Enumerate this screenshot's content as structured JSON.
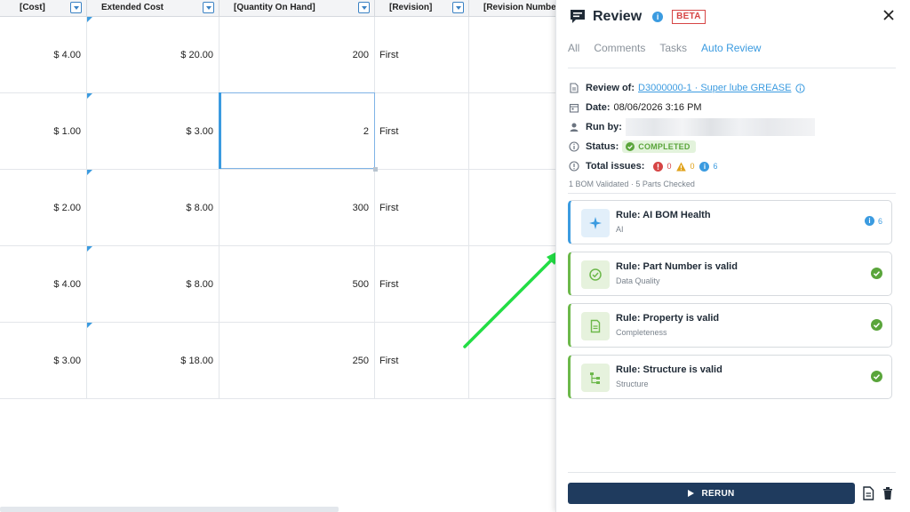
{
  "grid": {
    "columns": [
      "[Cost]",
      "Extended Cost",
      "[Quantity On Hand]",
      "[Revision]",
      "[Revision Number"
    ],
    "rows": [
      {
        "cost": "$ 4.00",
        "extended_cost": "$ 20.00",
        "qty": "200",
        "revision": "First"
      },
      {
        "cost": "$ 1.00",
        "extended_cost": "$ 3.00",
        "qty": "2",
        "revision": "First"
      },
      {
        "cost": "$ 2.00",
        "extended_cost": "$ 8.00",
        "qty": "300",
        "revision": "First"
      },
      {
        "cost": "$ 4.00",
        "extended_cost": "$ 8.00",
        "qty": "500",
        "revision": "First"
      },
      {
        "cost": "$ 3.00",
        "extended_cost": "$ 18.00",
        "qty": "250",
        "revision": "First"
      }
    ]
  },
  "panel": {
    "title": "Review",
    "beta": "BETA",
    "tabs": [
      "All",
      "Comments",
      "Tasks",
      "Auto Review"
    ],
    "active_tab": "Auto Review",
    "review_of_label": "Review of:",
    "review_of_value": "D3000000-1 · Super lube GREASE",
    "date_label": "Date:",
    "date_value": "08/06/2026 3:16 PM",
    "run_by_label": "Run by:",
    "status_label": "Status:",
    "status_value": "COMPLETED",
    "issues_label": "Total issues:",
    "issues": {
      "errors": "0",
      "warnings": "0",
      "info": "6"
    },
    "summary": "1 BOM Validated · 5 Parts Checked",
    "rules": [
      {
        "name": "Rule: AI BOM Health",
        "category": "AI",
        "status": "info",
        "count": "6",
        "icon": "sparkle-icon"
      },
      {
        "name": "Rule: Part Number is valid",
        "category": "Data Quality",
        "status": "ok",
        "icon": "check-circle-icon"
      },
      {
        "name": "Rule: Property is valid",
        "category": "Completeness",
        "status": "ok",
        "icon": "document-icon"
      },
      {
        "name": "Rule: Structure is valid",
        "category": "Structure",
        "status": "ok",
        "icon": "tree-icon"
      }
    ],
    "rerun_label": "RERUN"
  },
  "colors": {
    "accent": "#3b9be0",
    "success": "#6cb84a",
    "danger": "#d64545",
    "warning": "#e0a21a",
    "button": "#1f3b5e",
    "arrow": "#22dd44"
  }
}
